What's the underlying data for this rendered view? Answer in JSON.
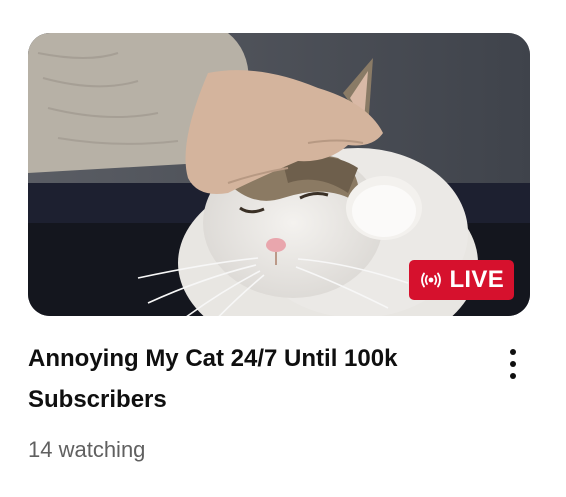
{
  "video": {
    "title": "Annoying My Cat 24/7 Until 100k Subscribers",
    "viewers": "14 watching",
    "badge": {
      "label": "LIVE",
      "icon": "live-broadcast-icon",
      "color": "#d6112d"
    },
    "menu_icon": "more-vert-icon"
  }
}
